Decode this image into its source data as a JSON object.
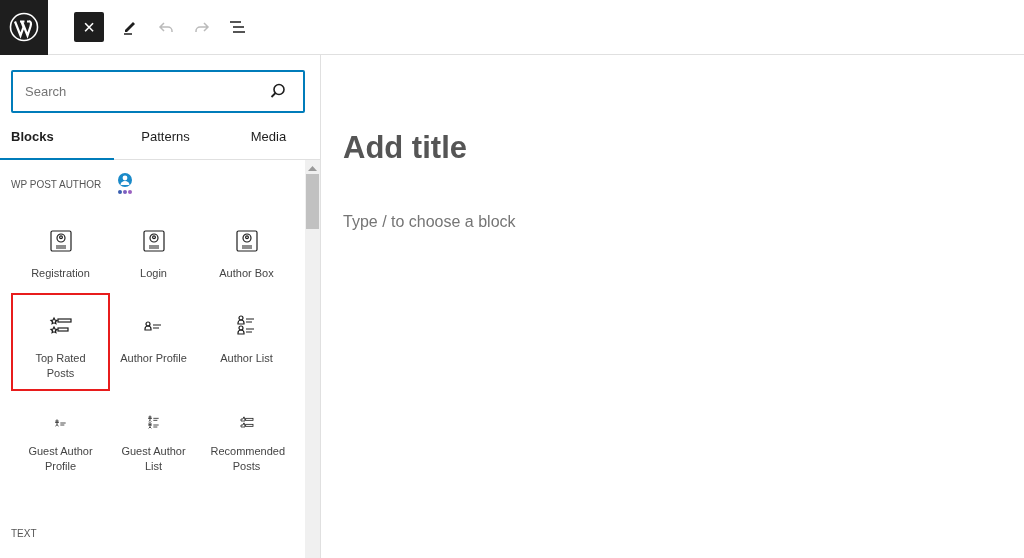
{
  "toolbar": {
    "close": "×"
  },
  "search": {
    "placeholder": "Search"
  },
  "tabs": [
    {
      "label": "Blocks",
      "selected": true
    },
    {
      "label": "Patterns",
      "selected": false
    },
    {
      "label": "Media",
      "selected": false
    }
  ],
  "sections": [
    {
      "title": "WP POST AUTHOR",
      "blocks": [
        {
          "label": "Registration",
          "kind": "badge",
          "highlighted": false
        },
        {
          "label": "Login",
          "kind": "badge",
          "highlighted": false
        },
        {
          "label": "Author Box",
          "kind": "badge",
          "highlighted": false
        },
        {
          "label": "Top Rated Posts",
          "kind": "star-list",
          "highlighted": true
        },
        {
          "label": "Author Profile",
          "kind": "person-line",
          "highlighted": false
        },
        {
          "label": "Author List",
          "kind": "person-list",
          "highlighted": false
        },
        {
          "label": "Guest Author Profile",
          "kind": "guest-line",
          "highlighted": false
        },
        {
          "label": "Guest Author List",
          "kind": "guest-list",
          "highlighted": false
        },
        {
          "label": "Recommended Posts",
          "kind": "thumb-list",
          "highlighted": false
        }
      ]
    },
    {
      "title": "TEXT"
    }
  ],
  "editor": {
    "title_placeholder": "Add title",
    "block_placeholder": "Type / to choose a block"
  }
}
